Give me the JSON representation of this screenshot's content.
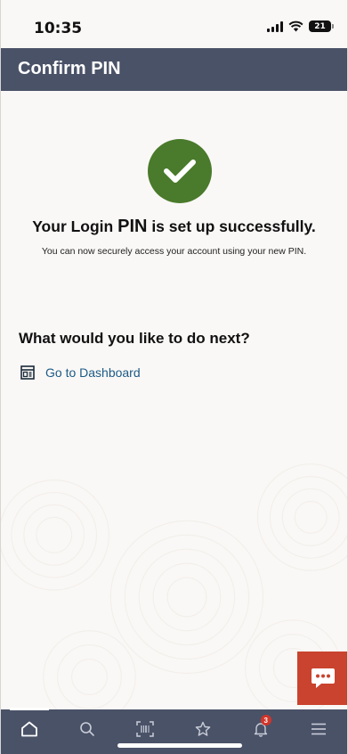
{
  "status_bar": {
    "time": "10:35",
    "battery": "21"
  },
  "header": {
    "title": "Confirm PIN"
  },
  "success": {
    "title_part1": "Your Login ",
    "title_pin": "PIN",
    "title_part2": " is set up successfully.",
    "subtitle": "You can now securely access your account using your new PIN."
  },
  "next": {
    "title": "What would you like to do next?",
    "dashboard_link": "Go to Dashboard"
  },
  "bottom_nav": {
    "items": [
      "home-icon",
      "search-icon",
      "scan-icon",
      "star-icon",
      "bell-icon",
      "menu-icon"
    ],
    "notification_count": "3"
  },
  "colors": {
    "header": "#4a5268",
    "success": "#4a7a2b",
    "link": "#1c5a86",
    "chat": "#c9432e"
  }
}
